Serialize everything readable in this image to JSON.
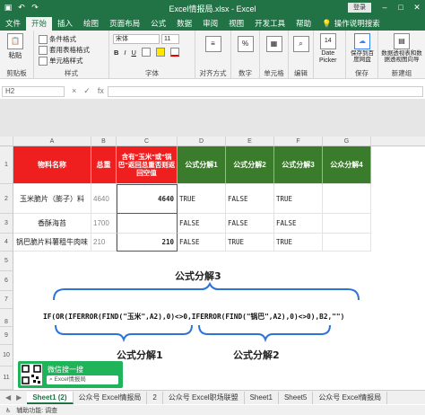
{
  "window": {
    "title": "Excel情报局.xlsx - Excel",
    "signin": "登录"
  },
  "ribbon_tabs": [
    "文件",
    "开始",
    "插入",
    "绘图",
    "页面布局",
    "公式",
    "数据",
    "审阅",
    "视图",
    "开发工具",
    "帮助"
  ],
  "tell_me": "操作说明搜索",
  "ribbon": {
    "clipboard": {
      "label": "剪贴板",
      "paste": "粘贴"
    },
    "styles": {
      "label": "样式",
      "cond_format": "条件格式",
      "table_format": "套用表格格式",
      "cell_styles": "单元格样式"
    },
    "font": {
      "label": "字体",
      "font_name": "宋体",
      "font_size": "11",
      "bold": "B",
      "italic": "I",
      "underline": "U"
    },
    "alignment": {
      "label": "对齐方式"
    },
    "number": {
      "label": "数字",
      "percent": "%"
    },
    "cells": {
      "label": "单元格"
    },
    "editing": {
      "label": "编辑"
    },
    "date_picker": {
      "label": "Date Picker",
      "line1": "Date",
      "line2": "Picker",
      "day": "14"
    },
    "save": {
      "label": "保存",
      "btn": "保存到百度网盘"
    },
    "new_group": {
      "label": "新建组",
      "btn": "数据透视表和数据透视图向导"
    }
  },
  "formula_bar": {
    "namebox": "H2",
    "cancel": "×",
    "enter": "✓",
    "fx": "fx"
  },
  "grid": {
    "col_headers": [
      "A",
      "B",
      "C",
      "D",
      "E",
      "F",
      "G"
    ],
    "row_headers": [
      "1",
      "2",
      "3",
      "4",
      "5",
      "6",
      "7",
      "8",
      "9",
      "10",
      "11"
    ],
    "header_row": {
      "a": "物料名称",
      "b": "总重",
      "c": "含有\"玉米\"或\"锅巴\"返回总重否则返回空值",
      "d": "公式分解1",
      "e": "公式分解2",
      "f": "公式分解3",
      "g": "公众分解4"
    },
    "rows": [
      {
        "a": "玉米脆片（膨子）料",
        "b": "4640",
        "c": "4640",
        "d": "TRUE",
        "e": "FALSE",
        "f": "TRUE"
      },
      {
        "a": "香酥海苔",
        "b": "1700",
        "c": "",
        "d": "FALSE",
        "e": "FALSE",
        "f": "FALSE"
      },
      {
        "a": "锅巴脆片料薯租牛肉味",
        "b": "210",
        "c": "210",
        "d": "FALSE",
        "e": "TRUE",
        "f": "TRUE"
      }
    ]
  },
  "annotation": {
    "label3": "公式分解3",
    "formula": "IF(OR(IFERROR(FIND(\"玉米\",A2),0)<>0,IFERROR(FIND(\"锅巴\",A2),0)<>0),B2,\"\")",
    "label1": "公式分解1",
    "label2": "公式分解2"
  },
  "wechat": {
    "name": "微信搜一搜",
    "search": "Excel情报局"
  },
  "sheet_tabs": [
    "Sheet1 (2)",
    "公众号 Excel情报局",
    "2",
    "公众号 Excel职场联盟",
    "Sheet1",
    "Sheet5",
    "公众号 Excel情报局"
  ],
  "status": {
    "text": "辅助功能: 调查"
  }
}
